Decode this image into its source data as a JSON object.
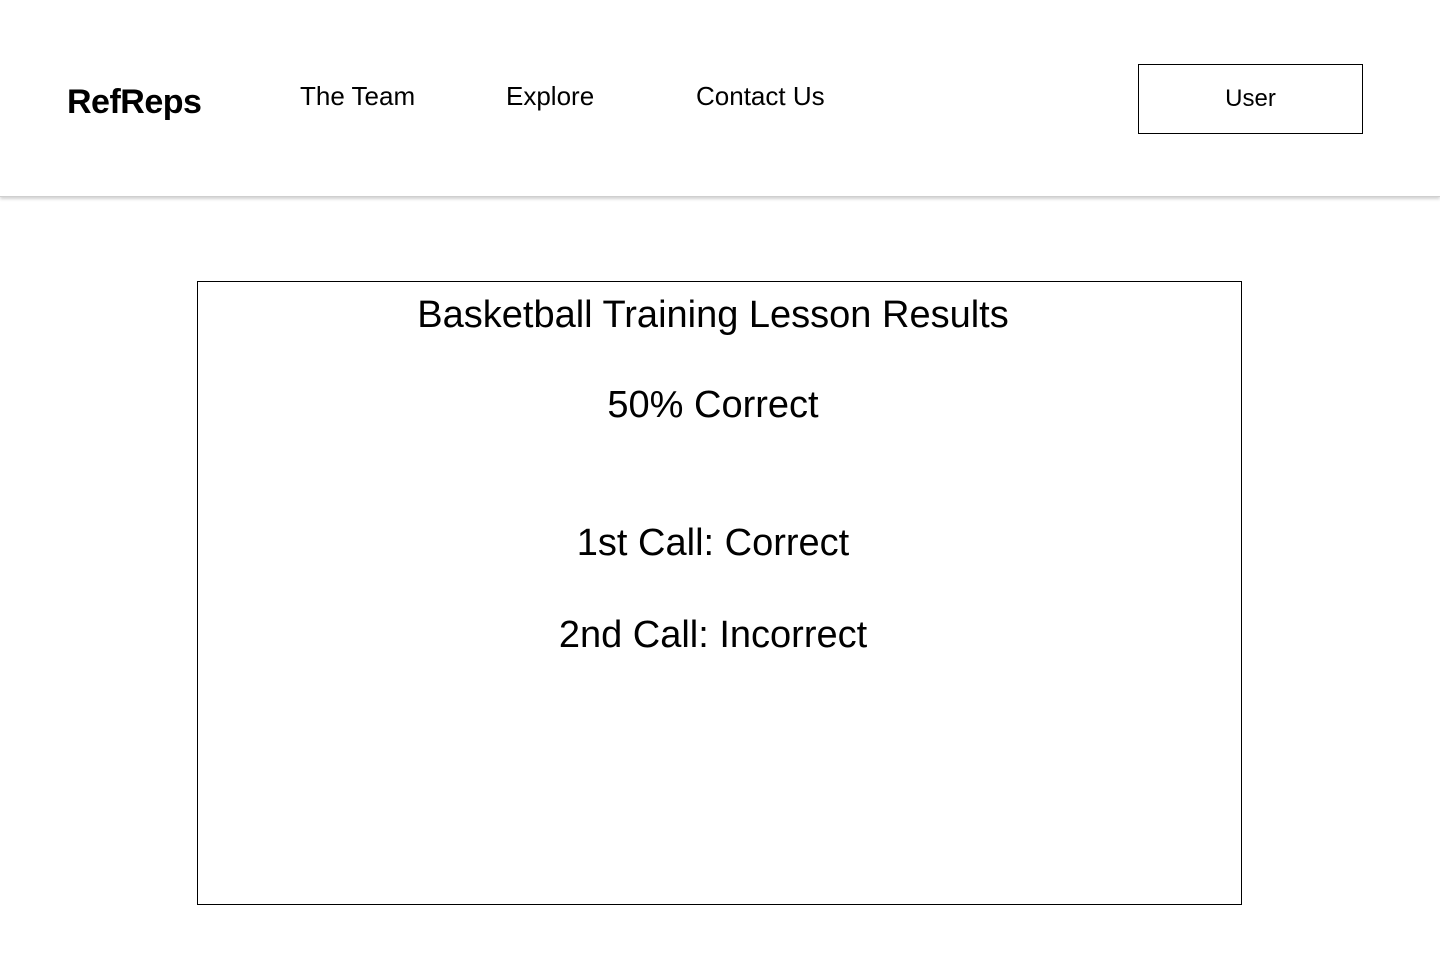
{
  "header": {
    "logo": "RefReps",
    "nav": {
      "team": "The Team",
      "explore": "Explore",
      "contact": "Contact Us"
    },
    "user_button": "User"
  },
  "results": {
    "title": "Basketball Training Lesson Results",
    "score": "50% Correct",
    "calls": [
      "1st Call: Correct",
      "2nd Call: Incorrect"
    ]
  }
}
